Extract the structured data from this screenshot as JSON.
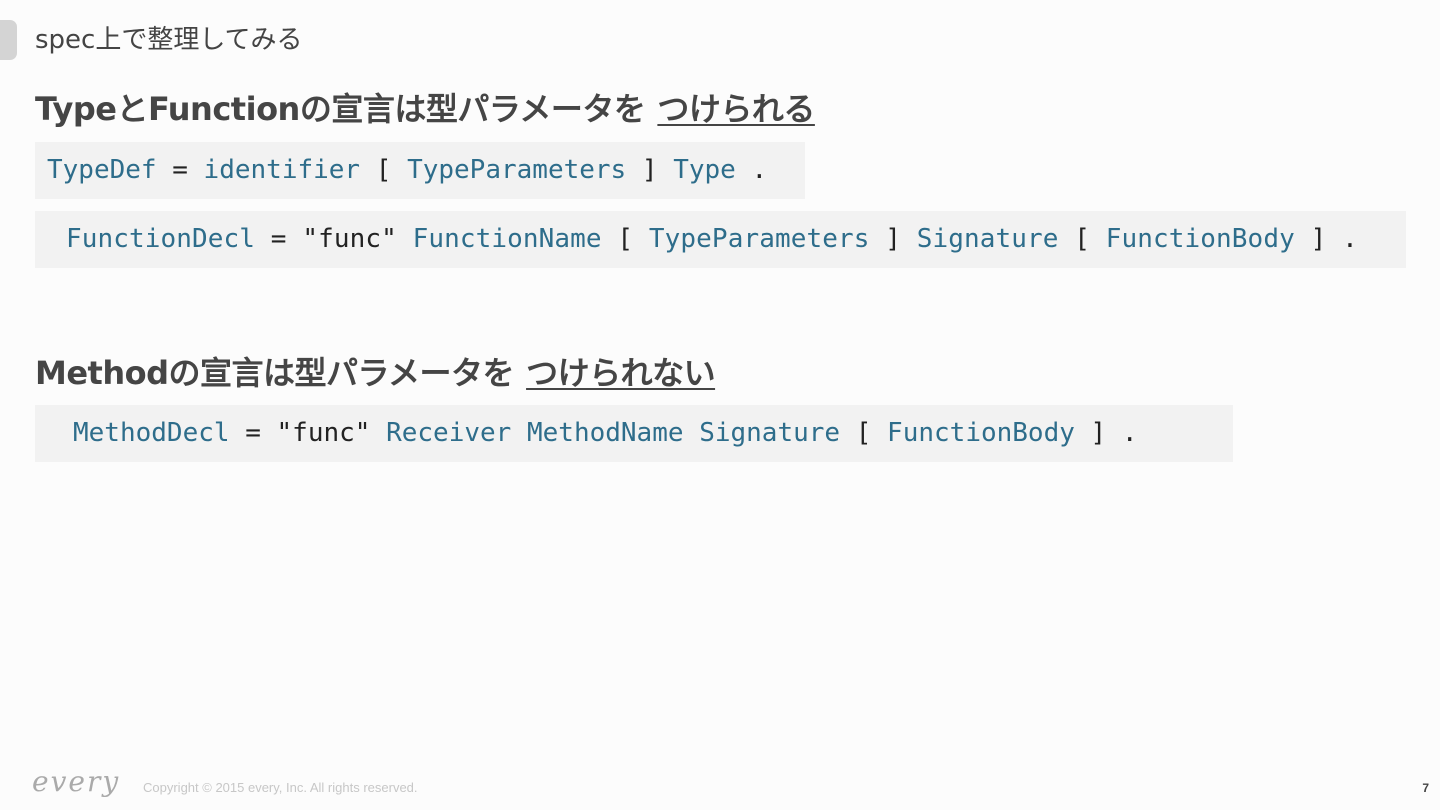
{
  "slide": {
    "title": "spec上で整理してみる",
    "page_number": "7"
  },
  "section1": {
    "heading_lead": "TypeとFunctionの宣言は型パラメータを",
    "heading_emphasis": "つけられる",
    "typedef": {
      "t1": "TypeDef",
      "t2": " = ",
      "t3": "identifier",
      "t4": " [ ",
      "t5": "TypeParameters",
      "t6": " ] ",
      "t7": "Type",
      "t8": " ."
    },
    "funcdecl": {
      "t1": "FunctionDecl",
      "t2": " = ",
      "t3": "\"func\"",
      "t4": " ",
      "t5": "FunctionName",
      "t6": " [ ",
      "t7": "TypeParameters",
      "t8": " ] ",
      "t9": "Signature",
      "t10": " [ ",
      "t11": "FunctionBody",
      "t12": " ] ."
    }
  },
  "section2": {
    "heading_lead": "Methodの宣言は型パラメータを",
    "heading_emphasis": "つけられない",
    "methoddecl": {
      "t1": "MethodDecl",
      "t2": " = ",
      "t3": "\"func\"",
      "t4": " ",
      "t5": "Receiver",
      "t6": " ",
      "t7": "MethodName",
      "t8": " ",
      "t9": "Signature",
      "t10": " [ ",
      "t11": "FunctionBody",
      "t12": " ] ."
    }
  },
  "footer": {
    "logo_text": "every",
    "copyright": "Copyright © 2015 every, Inc. All rights reserved."
  },
  "colors": {
    "identifier": "#2e6d8b",
    "code_background": "#f2f2f2",
    "text": "#444444"
  }
}
